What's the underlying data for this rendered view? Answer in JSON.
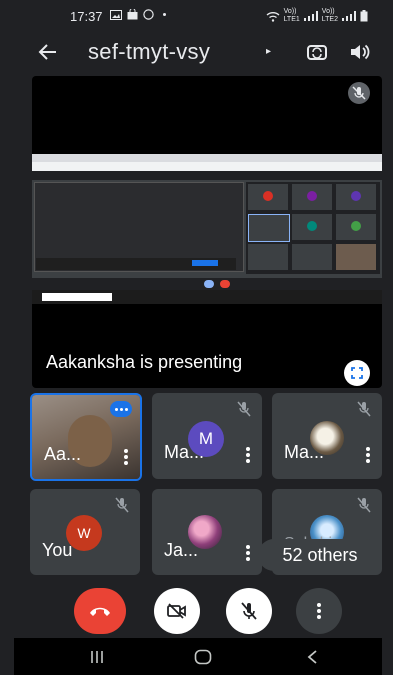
{
  "status_bar": {
    "time": "17:37",
    "network_labels": [
      "Vo))",
      "LTE1",
      "Vo))",
      "LTE2"
    ]
  },
  "header": {
    "meeting_code": "sef-tmyt-vsy",
    "caret": "▸"
  },
  "presentation": {
    "presenter_text": "Aakanksha  is presenting"
  },
  "tiles": [
    {
      "name": "Aa...",
      "kind": "video",
      "active_speaker": true
    },
    {
      "name": "Ma...",
      "kind": "letter",
      "letter": "M",
      "avatar_color": "#5c4bbf",
      "muted": true
    },
    {
      "name": "Ma...",
      "kind": "photo",
      "muted": true
    },
    {
      "name": "You",
      "kind": "letter",
      "letter": "W",
      "avatar_color": "#c5391e",
      "muted": true
    },
    {
      "name": "Ja...",
      "kind": "photo",
      "muted": false
    },
    {
      "name": "Sakshi",
      "kind": "photo",
      "muted": true
    }
  ],
  "others": {
    "label": "52 others"
  },
  "controls": {
    "end_call_color": "#ea4335",
    "items": [
      "end-call",
      "camera-off",
      "mic-off",
      "more-options"
    ]
  },
  "nav_bar": {
    "items": [
      "recents",
      "home",
      "back"
    ]
  },
  "colors": {
    "background": "#202124",
    "tile": "#3c4043",
    "accent_blue": "#1a73e8"
  }
}
